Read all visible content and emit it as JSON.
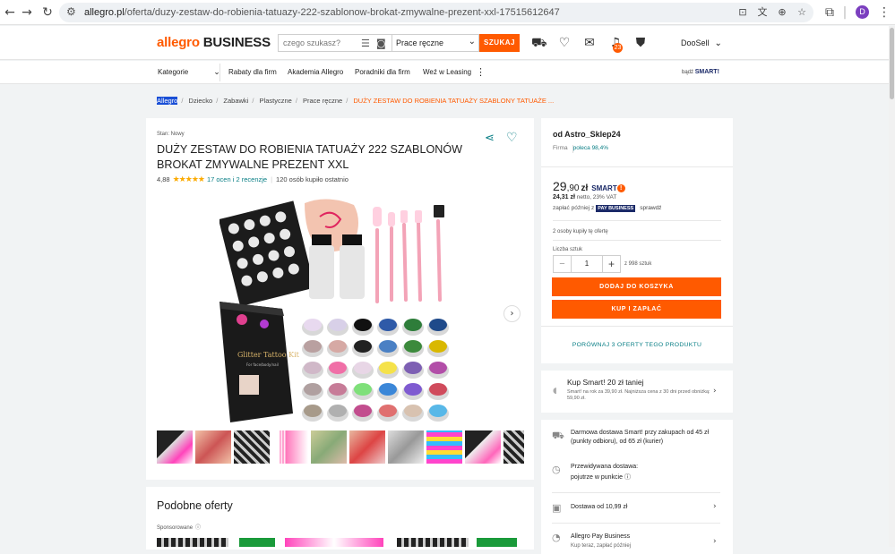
{
  "browser": {
    "url_domain": "allegro.pl",
    "url_path": "/oferta/duzy-zestaw-do-robienia-tatuazy-222-szablonow-brokat-zmywalne-prezent-xxl-17515612647",
    "profile_initial": "D"
  },
  "header": {
    "logo_allegro": "allegro",
    "logo_business": "BUSINESS",
    "search_placeholder": "czego szukasz?",
    "search_category": "Prace ręczne",
    "search_button": "SZUKAJ",
    "notifications_count": "23",
    "user_name": "DooSell"
  },
  "nav": {
    "categories": "Kategorie",
    "links": [
      "Rabaty dla firm",
      "Akademia Allegro",
      "Poradniki dla firm",
      "Weź w Leasing"
    ],
    "smart_prefix": "bądź",
    "smart_label": "SMART!"
  },
  "breadcrumb": {
    "first": "Allegro",
    "items": [
      "Dziecko",
      "Zabawki",
      "Plastyczne",
      "Prace ręczne"
    ],
    "current": "DUŻY ZESTAW DO ROBIENIA TATUAŻY SZABLONY TATUAŻE ..."
  },
  "product": {
    "condition": "Stan: Nowy",
    "title": "DUŻY ZESTAW DO ROBIENIA TATUAŻY 222 SZABLONÓW BROKAT ZMYWALNE PREZENT XXL",
    "rating_value": "4,88",
    "rating_stars": 5,
    "rating_link": "17 ocen i 2 recenzje",
    "bought_recent": "120 osób kupiło ostatnio",
    "box_label": "Glitter Tattoo Kit",
    "box_sub": "For face/body/nail"
  },
  "similar": {
    "title": "Podobne oferty",
    "sponsored": "Sponsorowane"
  },
  "seller": {
    "name": "od Astro_Sklep24",
    "type": "Firma",
    "recommend": "poleca 98,4%"
  },
  "pricing": {
    "price_main": "29",
    "price_cents": ",90",
    "currency": "zł",
    "smart_label": "SMART",
    "netto_value": "24,31 zł",
    "netto_text": "netto, 23% VAT",
    "pay_later": "zapłać później z",
    "pay_business": "PAY BUSINESS",
    "check": "sprawdź",
    "bought": "2 osoby kupiły tę ofertę",
    "qty_label": "Liczba sztuk",
    "qty_value": "1",
    "qty_of": "z 998 sztuk",
    "add_to_cart": "DODAJ DO KOSZYKA",
    "buy_pay": "KUP I ZAPŁAĆ",
    "compare": "PORÓWNAJ 3 OFERTY TEGO PRODUKTU"
  },
  "kup_smart": {
    "title": "Kup Smart! 20 zł taniej",
    "sub": "Smart! na rok za 39,90 zł. Najniższa cena z 30 dni przed obniżką: 59,90 zł."
  },
  "delivery": {
    "free": "Darmowa dostawa Smart! przy zakupach od 45 zł (punkty odbioru), od 65 zł (kurier)",
    "expected_label": "Przewidywana dostawa:",
    "expected_value": "pojutrze w punkcie",
    "from_price": "Dostawa od 10,99 zł",
    "pay_business": "Allegro Pay Business",
    "pay_business_sub": "Kup teraz, zapłać później"
  },
  "colors": {
    "accent": "#ff5a00",
    "teal": "#0a7f86",
    "navy": "#1b2a68"
  }
}
